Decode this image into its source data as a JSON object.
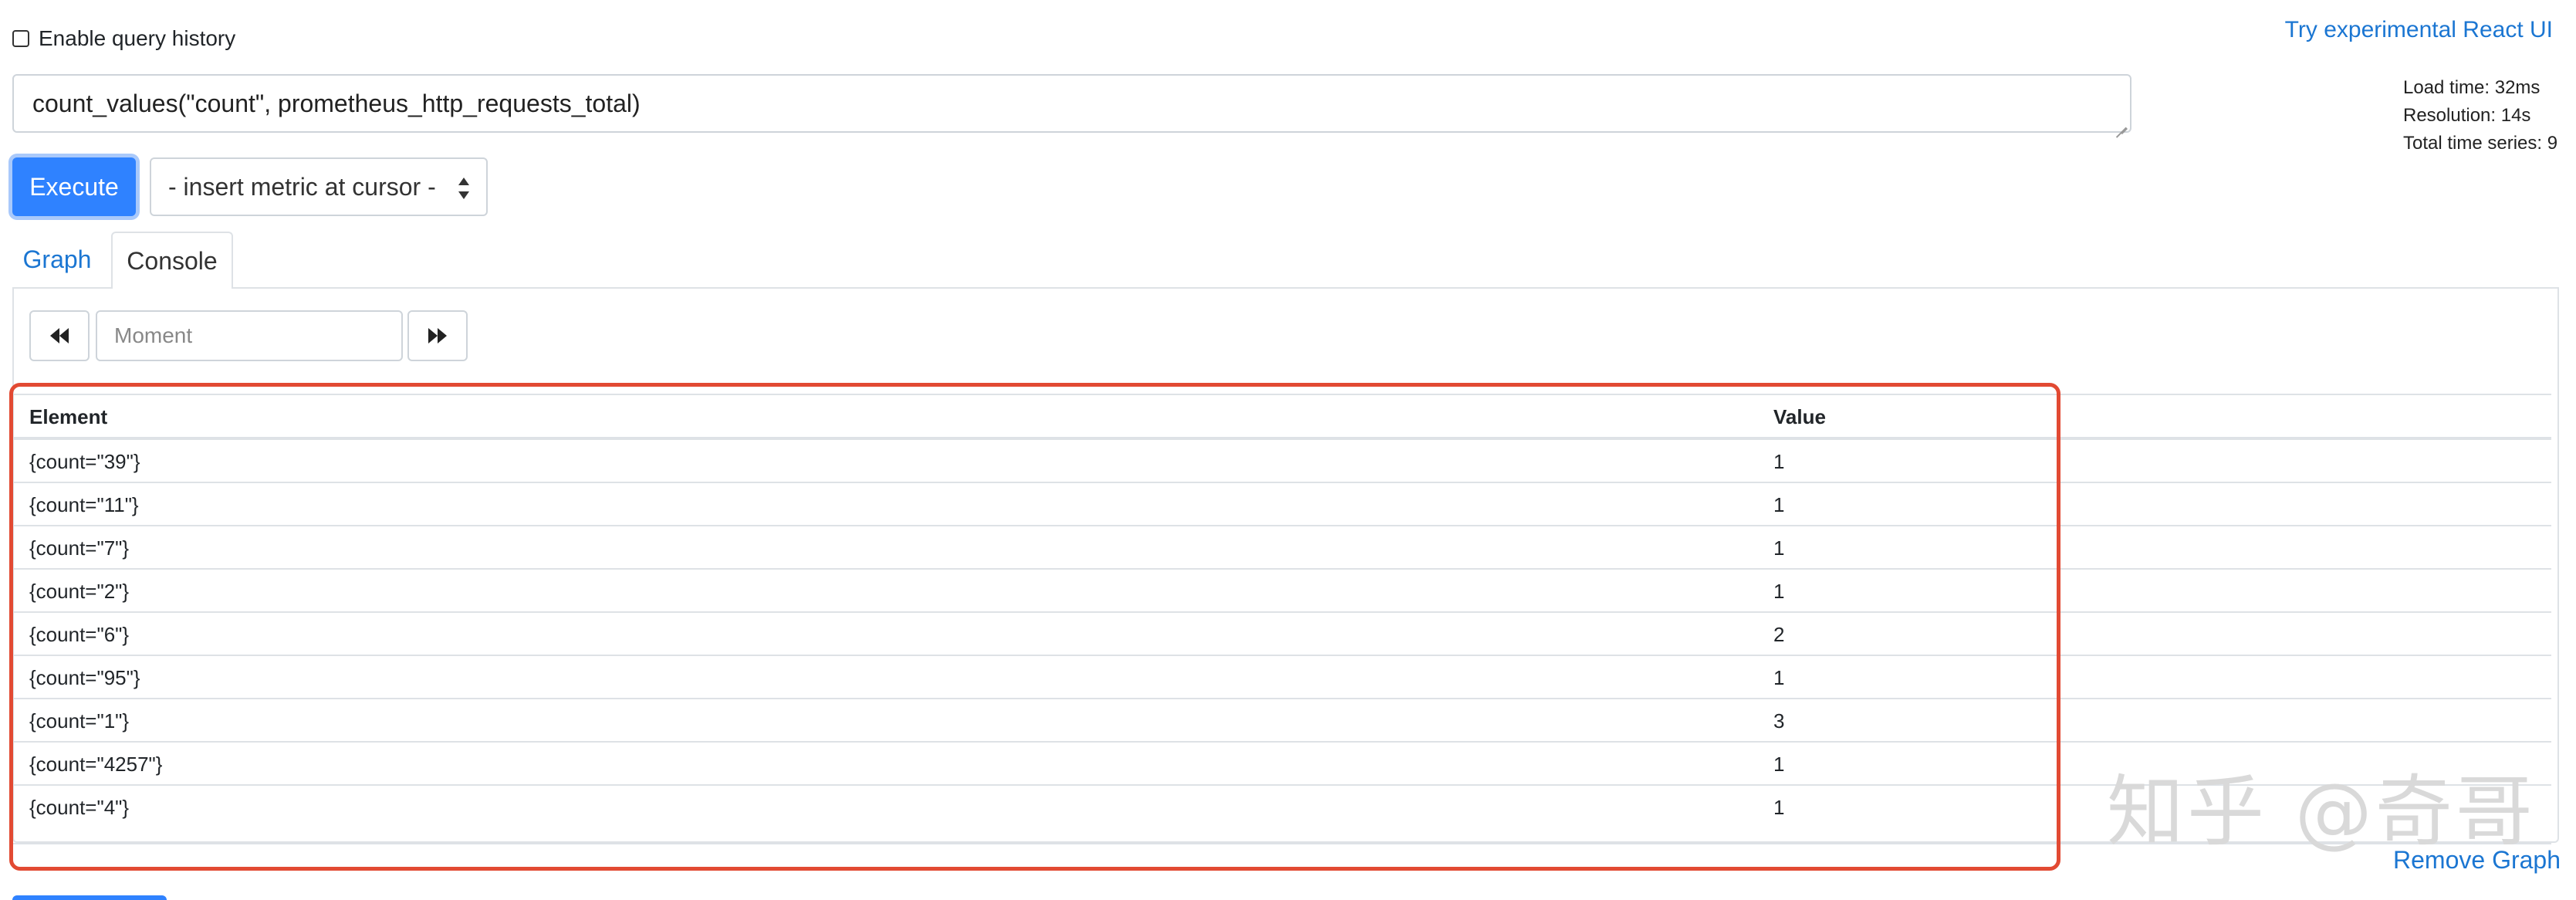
{
  "header": {
    "history_label": "Enable query history",
    "try_react_link": "Try experimental React UI"
  },
  "query": {
    "expression": "count_values(\"count\", prometheus_http_requests_total)"
  },
  "stats": {
    "load_time": "Load time: 32ms",
    "resolution": "Resolution: 14s",
    "total_series": "Total time series: 9"
  },
  "controls": {
    "execute_label": "Execute",
    "metric_select_value": "- insert metric at cursor -"
  },
  "tabs": [
    {
      "label": "Graph"
    },
    {
      "label": "Console"
    }
  ],
  "moment": {
    "placeholder": "Moment"
  },
  "table": {
    "headers": [
      "Element",
      "Value"
    ],
    "rows": [
      {
        "element": "{count=\"39\"}",
        "value": "1"
      },
      {
        "element": "{count=\"11\"}",
        "value": "1"
      },
      {
        "element": "{count=\"7\"}",
        "value": "1"
      },
      {
        "element": "{count=\"2\"}",
        "value": "1"
      },
      {
        "element": "{count=\"6\"}",
        "value": "2"
      },
      {
        "element": "{count=\"95\"}",
        "value": "1"
      },
      {
        "element": "{count=\"1\"}",
        "value": "3"
      },
      {
        "element": "{count=\"4257\"}",
        "value": "1"
      },
      {
        "element": "{count=\"4\"}",
        "value": "1"
      }
    ]
  },
  "footer": {
    "remove_graph": "Remove Graph"
  },
  "watermark": "知乎 @奇哥",
  "colors": {
    "primary": "#2f82ff",
    "link": "#1b76d2",
    "highlight": "#e24a33"
  }
}
